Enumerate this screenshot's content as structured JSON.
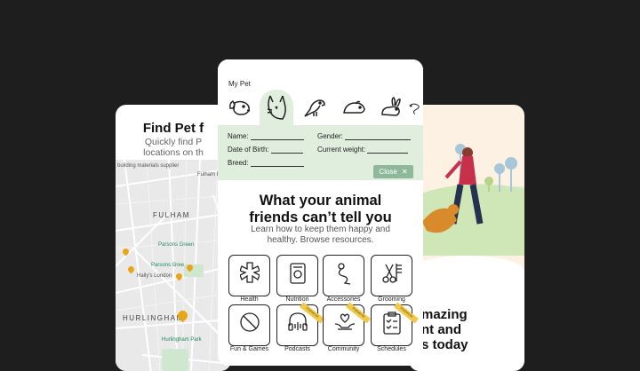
{
  "left": {
    "title": "Find Pet f",
    "subtitle_line1": "Quickly find P",
    "subtitle_line2": "locations on th",
    "map_labels": {
      "fulham": "FULHAM",
      "fulham_bro": "Fulham B",
      "parsons_green": "Parsons Green",
      "parsons_green2": "Parsons Gree",
      "hally": "Hally's London",
      "hurlingham": "HURLINGHAM",
      "hurlingham_park": "Hurlingham Park",
      "building_supplier": "building materials supplier"
    }
  },
  "center": {
    "my_pet_label": "My Pet",
    "pets": [
      "dog",
      "cat",
      "bird",
      "rodent",
      "rabbit",
      "reptile"
    ],
    "selected_pet": "cat",
    "form": {
      "name": "Name:",
      "gender": "Gender:",
      "dob": "Date of Birth:",
      "weight": "Current weight:",
      "breed": "Breed:"
    },
    "close_label": "Close",
    "heading_line1": "What your animal",
    "heading_line2": "friends can’t tell you",
    "desc_line1": "Learn how to keep them happy and",
    "desc_line2": "healthy. Browse resources.",
    "tiles": [
      {
        "label": "Health",
        "icon": "medical-star-icon",
        "premium": false
      },
      {
        "label": "Nutrition",
        "icon": "food-bag-icon",
        "premium": false
      },
      {
        "label": "Accessories",
        "icon": "leash-icon",
        "premium": false
      },
      {
        "label": "Grooming",
        "icon": "scissors-comb-icon",
        "premium": false
      },
      {
        "label": "Fun & Games",
        "icon": "ball-icon",
        "premium": false
      },
      {
        "label": "Podcasts",
        "icon": "headphones-icon",
        "premium": true
      },
      {
        "label": "Community",
        "icon": "hands-heart-icon",
        "premium": true
      },
      {
        "label": "Schedules",
        "icon": "checklist-icon",
        "premium": true
      }
    ],
    "premium_label": "PREMIUM"
  },
  "right": {
    "line1": "mazing",
    "line2": "nt and",
    "line3": "s today"
  },
  "colors": {
    "background": "#1e1e1e",
    "green_panel": "#dfeedd",
    "close_button": "#8fb89a",
    "premium": "#f2c94c",
    "pin": "#e9a516"
  }
}
